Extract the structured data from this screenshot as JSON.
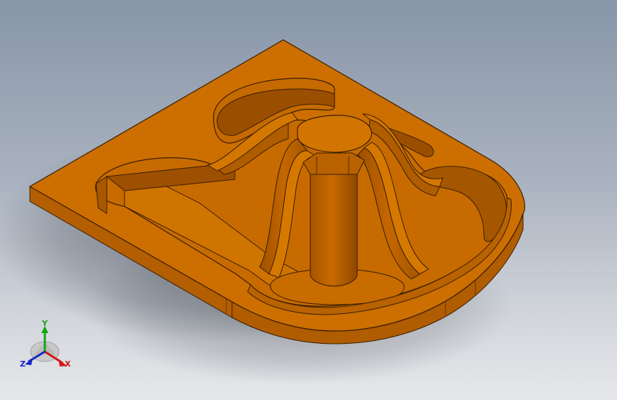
{
  "viewport": {
    "model_colors": {
      "top": "#cc6f00",
      "side": "#b65f00",
      "side_dark": "#8a4700",
      "edge": "#3a1d00",
      "inner": "#d97c10"
    }
  },
  "triad": {
    "x_label": "X",
    "y_label": "Y",
    "z_label": "Z",
    "x_color": "#d01818",
    "y_color": "#14a514",
    "z_color": "#1428c8"
  }
}
